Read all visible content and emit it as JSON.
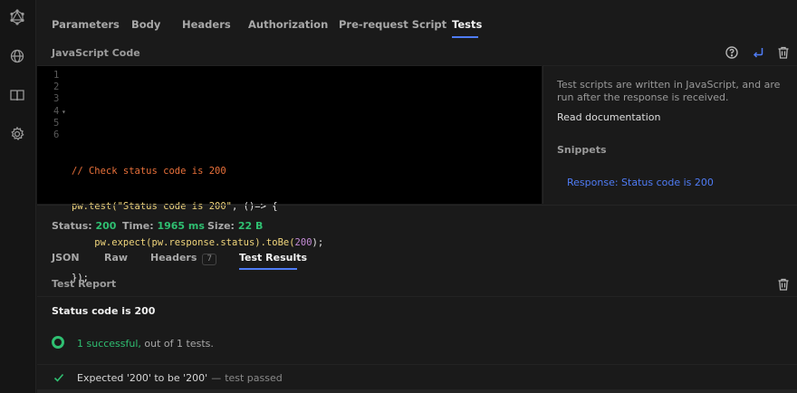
{
  "sidebar": {
    "icons": [
      "graphql-icon",
      "globe-icon",
      "book-icon",
      "gear-icon"
    ]
  },
  "request_tabs": [
    "Parameters",
    "Body",
    "Headers",
    "Authorization",
    "Pre-request Script",
    "Tests"
  ],
  "active_request_tab": "Tests",
  "editor": {
    "section_title": "JavaScript Code",
    "line_numbers": [
      "1",
      "2",
      "3",
      "4",
      "5",
      "6"
    ],
    "lines": {
      "l3_comment": "// Check status code is 200",
      "l4_a": "pw.test(",
      "l4_str": "\"Status code is 200\"",
      "l4_b": ", ()=> {",
      "l5_a": "    pw.expect(pw.response.status).toBe(",
      "l5_num": "200",
      "l5_b": ");",
      "l6": "});"
    }
  },
  "side_panel": {
    "description": "Test scripts are written in JavaScript, and are run after the response is received.",
    "read_docs": "Read documentation",
    "snippets_heading": "Snippets",
    "snippet_item": "Response: Status code is 200"
  },
  "status": {
    "status_label": "Status:",
    "status_value": "200",
    "time_label": "Time:",
    "time_value": "1965 ms",
    "size_label": "Size:",
    "size_value": "22 B"
  },
  "response_tabs": {
    "json": "JSON",
    "raw": "Raw",
    "headers": "Headers",
    "headers_count": "7",
    "test_results": "Test Results"
  },
  "report": {
    "title": "Test Report",
    "test_name": "Status code is 200",
    "summary_ok": "1 successful,",
    "summary_rest": " out of 1 tests.",
    "result_text": "Expected '200' to be '200'",
    "result_dash": "—",
    "result_status": "test passed"
  },
  "colors": {
    "accent": "#4f7cf5",
    "success": "#2fbf71",
    "comment": "#e8703a",
    "string": "#f1d67c",
    "number": "#c48bd6"
  }
}
